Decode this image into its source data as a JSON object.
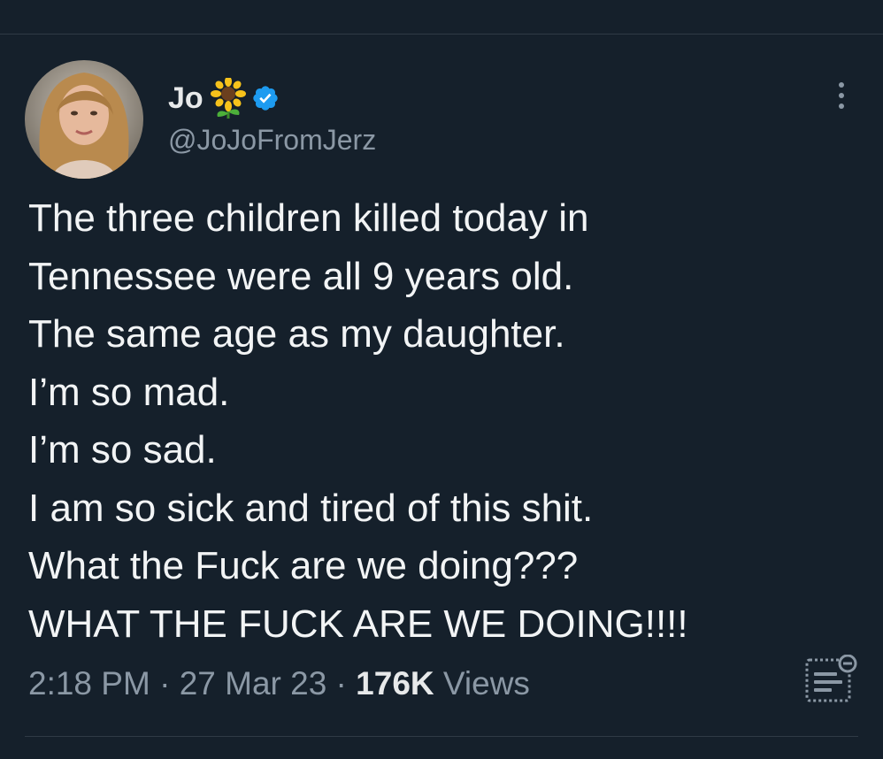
{
  "author": {
    "display_name": "Jo",
    "name_emoji": "sunflower-icon",
    "verified_icon": "verified-badge-icon",
    "handle": "@JoJoFromJerz"
  },
  "tweet": {
    "lines": [
      "The three children killed today in",
      "Tennessee were all 9 years old.",
      "The same age as my daughter.",
      "I’m so mad.",
      "I’m so sad.",
      "I am so sick and tired of this shit.",
      "What the Fuck are we doing???",
      "WHAT THE FUCK ARE WE DOING!!!!"
    ]
  },
  "meta": {
    "time": "2:18 PM",
    "separator": " · ",
    "date": "27 Mar 23",
    "views_count": "176K",
    "views_label": " Views"
  },
  "colors": {
    "background": "#15202b",
    "text": "#e7e9ea",
    "muted": "#8b98a5",
    "verified": "#1d9bf0"
  }
}
